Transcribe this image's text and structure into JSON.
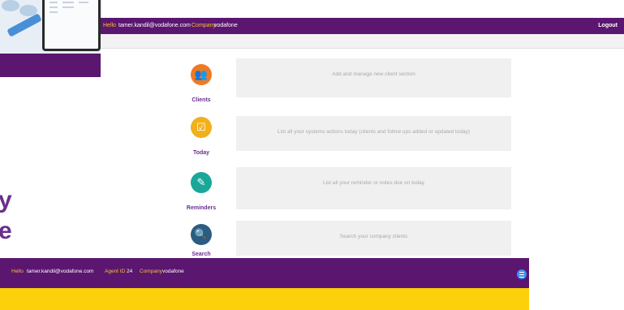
{
  "colors": {
    "brand_purple": "#5b1670",
    "accent_gold": "#f2c230",
    "yellow": "#fcd00b",
    "menu_blue": "#3f8ff0"
  },
  "promo": {
    "letter_1": "y",
    "letter_2": "e"
  },
  "header": {
    "hello": "Hello",
    "email": "tamer.kandil@vodafone.com",
    "company_label": "Company",
    "company_value": "vodafone",
    "logout": "Logout"
  },
  "items": [
    {
      "label": "Clients",
      "icon": "clients-icon",
      "color": "#f07a24",
      "glyph": "👥",
      "description": "Add and manage new client  section"
    },
    {
      "label": "Today",
      "icon": "today-checklist-icon",
      "color": "#f2b01c",
      "glyph": "☑",
      "description": "List all your systems actions today (clients and follow ups added or updated today)"
    },
    {
      "label": "Reminders",
      "icon": "reminder-note-icon",
      "color": "#19a79a",
      "glyph": "✎",
      "description": "List all your reminder or notes due on today"
    },
    {
      "label": "Search",
      "icon": "search-document-icon",
      "color": "#2b5c82",
      "glyph": "🔍",
      "description": "Search your company clients"
    }
  ],
  "mobile": {
    "hello": "Hello",
    "email": "tamer.kandil@vodafone.com",
    "agent_label": "Agent ID",
    "agent_value": "24",
    "company_label": "Company",
    "company_value": "vodafone"
  }
}
